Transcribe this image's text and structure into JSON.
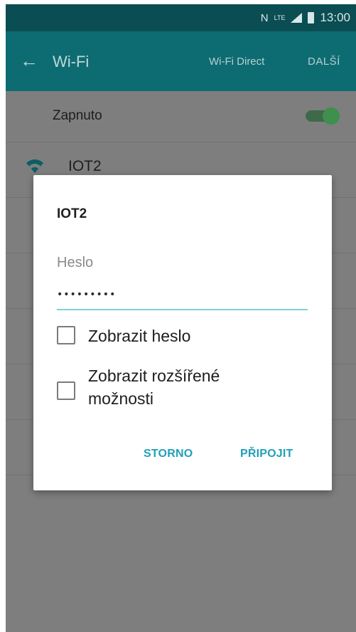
{
  "status_bar": {
    "icons": [
      "nfc-icon",
      "lte-icon",
      "signal-icon",
      "battery-icon"
    ],
    "lte_label": "LTE",
    "time": "13:00"
  },
  "app_bar": {
    "back_icon": "arrow-left-icon",
    "title": "Wi-Fi",
    "wifi_direct": "Wi-Fi Direct",
    "more": "DALŠÍ"
  },
  "toggle": {
    "label": "Zapnuto",
    "state": "on"
  },
  "networks": [
    {
      "name": "IOT2",
      "icon": "wifi-icon"
    }
  ],
  "dialog": {
    "title": "IOT2",
    "password_label": "Heslo",
    "password_value": "•••••••••",
    "show_password": "Zobrazit heslo",
    "advanced_options": "Zobrazit rozšířené možnosti",
    "cancel": "STORNO",
    "connect": "PŘIPOJIT"
  },
  "colors": {
    "status_bar": "#0a4d52",
    "app_bar": "#0d6c72",
    "accent": "#21a0b8",
    "switch_on": "#3f8f4d",
    "underline": "#7fd0d4"
  }
}
